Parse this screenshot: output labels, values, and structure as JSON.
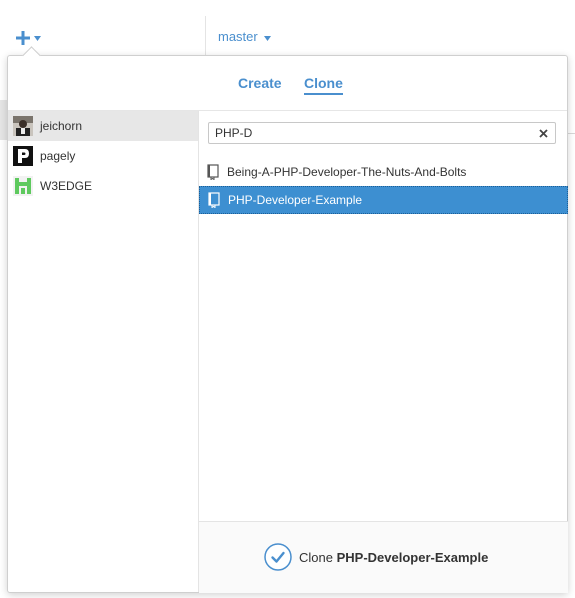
{
  "toolbar": {
    "branch_label": "master"
  },
  "popover": {
    "tabs": [
      {
        "label": "Create"
      },
      {
        "label": "Clone"
      }
    ],
    "accounts": [
      {
        "name": "jeichorn",
        "selected": true
      },
      {
        "name": "pagely",
        "selected": false
      },
      {
        "name": "W3EDGE",
        "selected": false
      }
    ],
    "search": {
      "value": "PHP-D"
    },
    "repos": [
      {
        "name": "Being-A-PHP-Developer-The-Nuts-And-Bolts",
        "selected": false
      },
      {
        "name": "PHP-Developer-Example",
        "selected": true
      }
    ],
    "footer": {
      "prefix": "Clone",
      "repo": "PHP-Developer-Example"
    }
  },
  "colors": {
    "accent": "#4a8fce",
    "selection": "#3d8fd1"
  },
  "icons": [
    "plus-icon",
    "caret-down-icon",
    "clear-icon",
    "repo-icon",
    "check-circle-icon"
  ]
}
